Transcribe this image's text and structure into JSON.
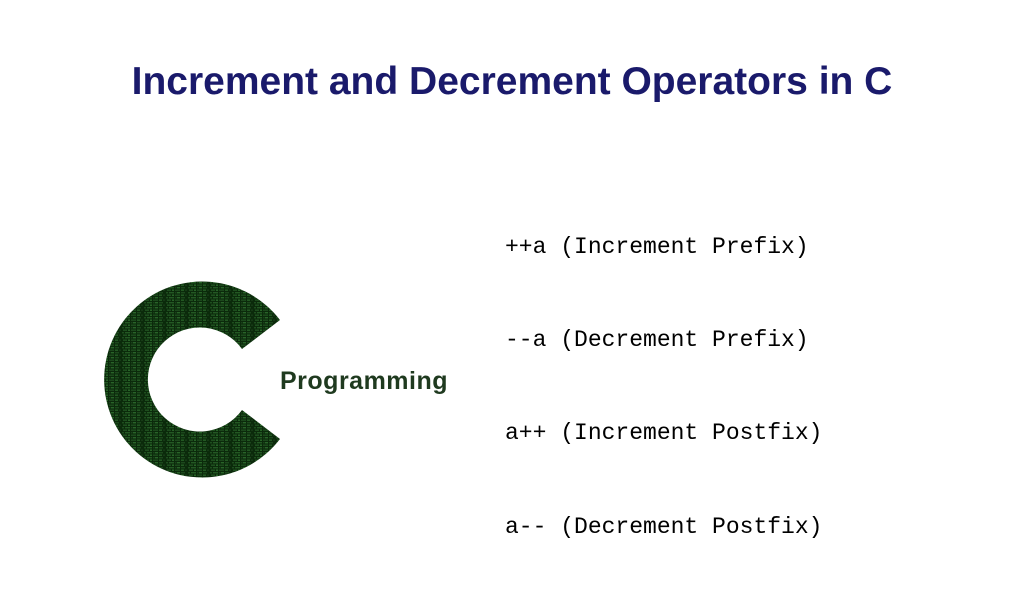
{
  "title": "Increment and Decrement Operators in C",
  "logo": {
    "label": "Programming"
  },
  "operators": [
    "++a (Increment Prefix)",
    "--a (Decrement Prefix)",
    "a++ (Increment Postfix)",
    "a-- (Decrement Postfix)"
  ]
}
